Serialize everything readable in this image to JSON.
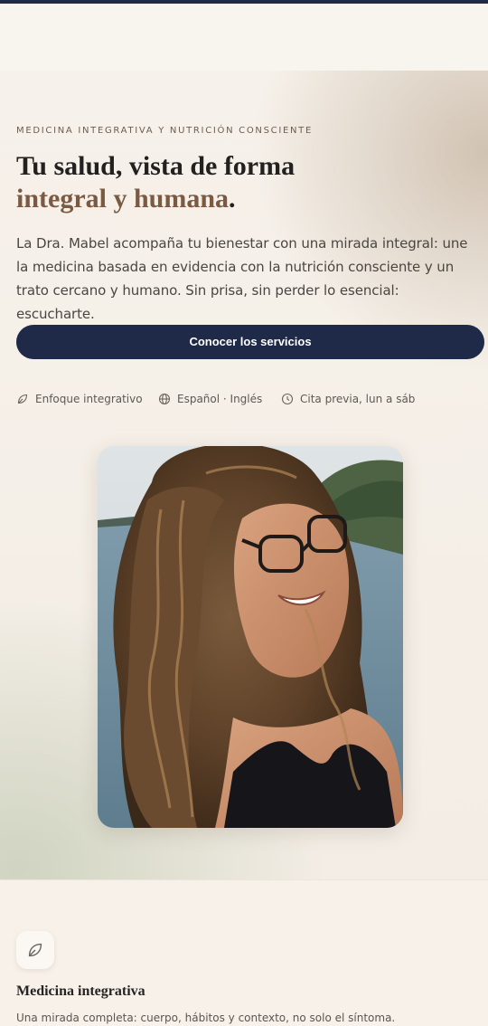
{
  "hero": {
    "eyebrow": "MEDICINA INTEGRATIVA Y NUTRICIÓN CONSCIENTE",
    "title_line1": "Tu salud, vista de forma",
    "title_line2": "integral y humana",
    "title_period": ".",
    "lede": "La Dra. Mabel acompaña tu bienestar con una mirada integral: une la medicina basada en evidencia con la nutrición consciente y un trato cercano y humano. Sin prisa, sin perder lo esencial: escucharte.",
    "cta_label": "Conocer los servicios",
    "features": [
      {
        "icon": "leaf-icon",
        "label": "Enfoque integrativo"
      },
      {
        "icon": "globe-icon",
        "label": "Español · Inglés"
      },
      {
        "icon": "clock-icon",
        "label": "Cita previa, lun a sáb"
      }
    ]
  },
  "portrait": {
    "alt": "Retrato de la Dra. Mabel"
  },
  "services": {
    "card": {
      "icon": "leaf-icon",
      "title": "Medicina integrativa",
      "text": "Una mirada completa: cuerpo, hábitos y contexto, no solo el síntoma."
    }
  },
  "colors": {
    "navy": "#1f2a48",
    "accent_brown": "#7a5a43",
    "background": "#f8f5ef"
  }
}
